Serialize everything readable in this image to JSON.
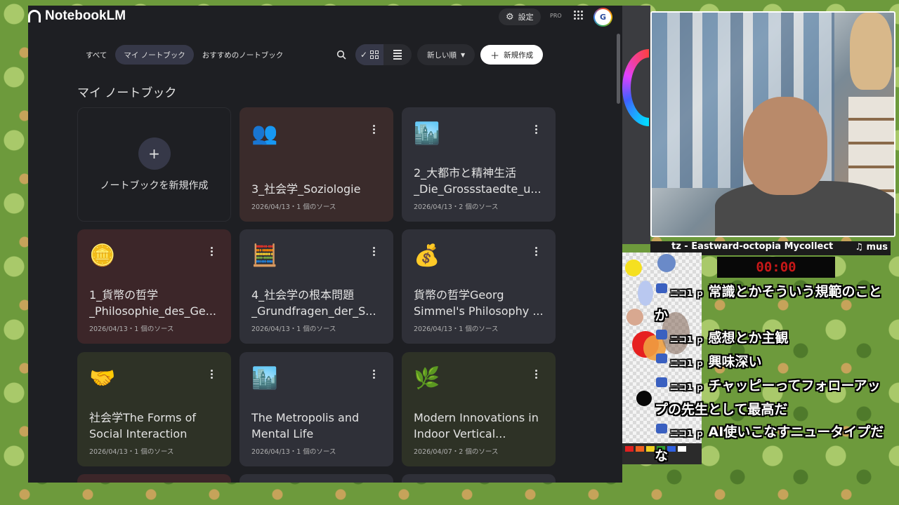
{
  "app": {
    "name": "NotebookLM",
    "settings_label": "設定",
    "pro_badge": "PRO",
    "avatar_text": "G"
  },
  "filters": [
    {
      "label": "すべて",
      "active": false
    },
    {
      "label": "マイ ノートブック",
      "active": true
    },
    {
      "label": "おすすめのノートブック",
      "active": false
    }
  ],
  "toolbar": {
    "search_icon": "search-icon",
    "view_selected": "grid",
    "sort_label": "新しい順",
    "new_button_label": "新規作成"
  },
  "section_title": "マイ ノートブック",
  "new_card_label": "ノートブックを新規作成",
  "notebooks": [
    {
      "emoji": "👥",
      "title": "3_社会学_Soziologie",
      "meta": "2026/04/13・1 個のソース",
      "color": "#3a2b2b"
    },
    {
      "emoji": "🏙️",
      "title": "2_大都市と精神生活_Die_Grossstaedte_u...",
      "meta": "2026/04/13・2 個のソース",
      "color": "#2f3038"
    },
    {
      "emoji": "🪙",
      "title": "1_貨幣の哲学_Philosophie_des_Ge...",
      "meta": "2026/04/13・1 個のソース",
      "color": "#3c2629"
    },
    {
      "emoji": "🧮",
      "title": "4_社会学の根本問題_Grundfragen_der_S...",
      "meta": "2026/04/13・1 個のソース",
      "color": "#2f3038"
    },
    {
      "emoji": "💰",
      "title": "貨幣の哲学Georg Simmel's Philosophy ...",
      "meta": "2026/04/13・1 個のソース",
      "color": "#2f3038"
    },
    {
      "emoji": "🤝",
      "title": "社会学The Forms of Social Interaction",
      "meta": "2026/04/13・1 個のソース",
      "color": "#2e3226"
    },
    {
      "emoji": "🏙️",
      "title": "The Metropolis and Mental Life",
      "meta": "2026/04/13・1 個のソース",
      "color": "#2f3038"
    },
    {
      "emoji": "🌿",
      "title": "Modern Innovations in Indoor Vertical...",
      "meta": "2026/04/07・2 個のソース",
      "color": "#2e3226"
    }
  ],
  "stream": {
    "ticker_text": "tz - Eastward-octopia Mycollect",
    "ticker_icon": "♫ mus",
    "timer": "00:00",
    "comments": [
      {
        "user": "ニコ1 ｐ",
        "text": "常識とかそういう規範のことか"
      },
      {
        "user": "ニコ1 ｐ",
        "text": "感想とか主観"
      },
      {
        "user": "ニコ1 ｐ",
        "text": "興味深い"
      },
      {
        "user": "ニコ1 ｐ",
        "text": "チャッピーってフォローアップの先生として最高だ"
      },
      {
        "user": "ニコ1 ｐ",
        "text": "AI使いこなすニュータイプだな"
      }
    ]
  }
}
